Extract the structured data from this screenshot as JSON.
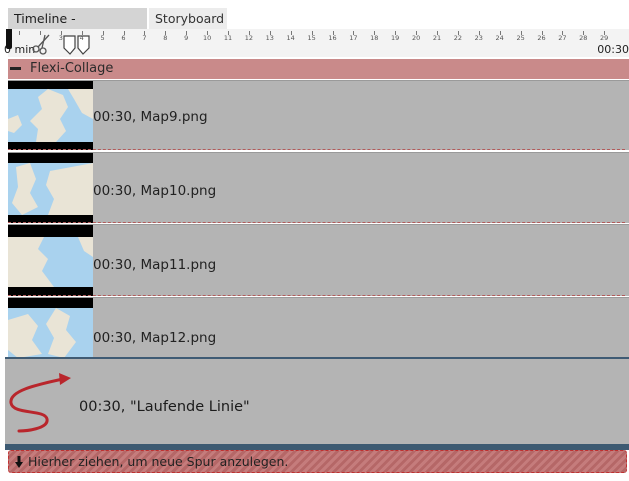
{
  "tabs": [
    {
      "label": "Timeline - Spuransicht",
      "active": true
    },
    {
      "label": "Storyboard",
      "active": false
    }
  ],
  "ruler": {
    "start_label": "0 min",
    "end_label": "00:30",
    "tick_labels": [
      "1",
      "2",
      "3",
      "4",
      "5",
      "6",
      "7",
      "8",
      "9",
      "10",
      "11",
      "12",
      "13",
      "14",
      "15",
      "16",
      "17",
      "18",
      "19",
      "20",
      "21",
      "22",
      "23",
      "24",
      "25",
      "26",
      "27",
      "28",
      "29"
    ]
  },
  "collage": {
    "label": "Flexi-Collage"
  },
  "tracks": [
    {
      "label": "00:30, Map9.png"
    },
    {
      "label": "00:30, Map10.png"
    },
    {
      "label": "00:30, Map11.png"
    },
    {
      "label": "00:30, Map12.png"
    }
  ],
  "linie": {
    "label": "00:30, \"Laufende Linie\""
  },
  "dropzone": {
    "label": "Hierher ziehen, um neue Spur anzulegen."
  },
  "colors": {
    "collage_bar": "#c98a8a",
    "track_bg": "#b4b4b4",
    "dropzone": "#c57c7c",
    "separator": "#3d5a72"
  }
}
